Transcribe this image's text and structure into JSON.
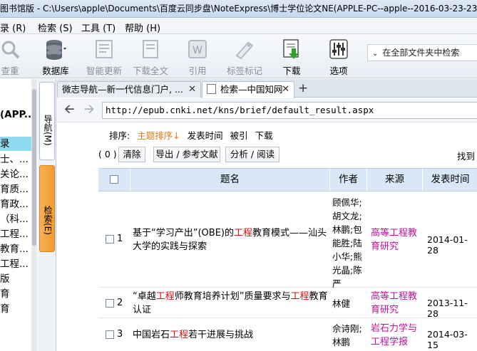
{
  "window": {
    "title": "图书馆版 - C:\\Users\\apple\\Documents\\百度云同步盘\\NoteExpress\\博士学位论文NE(APPLE-PC--apple--2016-03-23-23"
  },
  "menu": {
    "items": [
      "录 (R)",
      "检索 (S)",
      "工具 (T)",
      "帮助 (H)"
    ]
  },
  "toolbar": {
    "buttons": [
      {
        "label": "查重",
        "icon": "find-duplicates-icon"
      },
      {
        "label": "数据库",
        "icon": "database-icon"
      },
      {
        "label": "智能更新",
        "icon": "smart-update-icon"
      },
      {
        "label": "下载全文",
        "icon": "download-fulltext-icon"
      },
      {
        "label": "引用",
        "icon": "cite-icon"
      },
      {
        "label": "标签标记",
        "icon": "tag-icon"
      },
      {
        "label": "下载",
        "icon": "download-icon"
      },
      {
        "label": "选项",
        "icon": "options-icon"
      }
    ],
    "search_scope": "在全部文件夹中检索"
  },
  "sidebar": {
    "items": [
      "(APP...",
      "录",
      "士、...",
      "关论...",
      "育质...",
      "育政...",
      "（科...",
      "工程...",
      "教育...",
      "工程...",
      "版",
      "育",
      "育"
    ]
  },
  "vtabs": {
    "browse": "导航(M)",
    "search": "检索(E)"
  },
  "browser": {
    "tabs": [
      "微志导航—新一代信息门户, ...",
      "检索—中国知网"
    ],
    "url": "http://epub.cnki.net/kns/brief/default_result.aspx"
  },
  "results": {
    "sort_label": "排序:",
    "sort_options": [
      "主题排序↓",
      "发表时间",
      "被引",
      "下载"
    ],
    "selected_count": "( 0 )",
    "clear_label": "清除",
    "export_label": "导出 / 参考文献",
    "analyze_label": "分析 / 阅读",
    "found_label": "找到",
    "columns": [
      "题名",
      "作者",
      "来源",
      "发表时间"
    ],
    "rows": [
      {
        "num": "1",
        "title_parts": [
          {
            "t": "基于“学习产出”(OBE)的",
            "hl": false
          },
          {
            "t": "工程",
            "hl": true
          },
          {
            "t": "教育模式——汕头大学的实践与探索",
            "hl": false
          }
        ],
        "author": "顾佩华;胡文龙;林鹏;包能胜;陆小华;熊光晶;陈严",
        "source": "高等工程教育研究",
        "date": "2014-01-28"
      },
      {
        "num": "2",
        "title_parts": [
          {
            "t": "“卓越",
            "hl": false
          },
          {
            "t": "工程",
            "hl": true
          },
          {
            "t": "师教育培养计划”质量要求与",
            "hl": false
          },
          {
            "t": "工程",
            "hl": true
          },
          {
            "t": "教育认证",
            "hl": false
          }
        ],
        "author": "林健",
        "source": "高等工程教育研究",
        "date": "2013-11-28"
      },
      {
        "num": "3",
        "title_parts": [
          {
            "t": "中国岩石",
            "hl": false
          },
          {
            "t": "工程",
            "hl": true
          },
          {
            "t": "若干进展与挑战",
            "hl": false
          }
        ],
        "author": "佘诗刚;林鹏",
        "source": "岩石力学与工程学报",
        "date": "2014-03-15"
      }
    ]
  }
}
